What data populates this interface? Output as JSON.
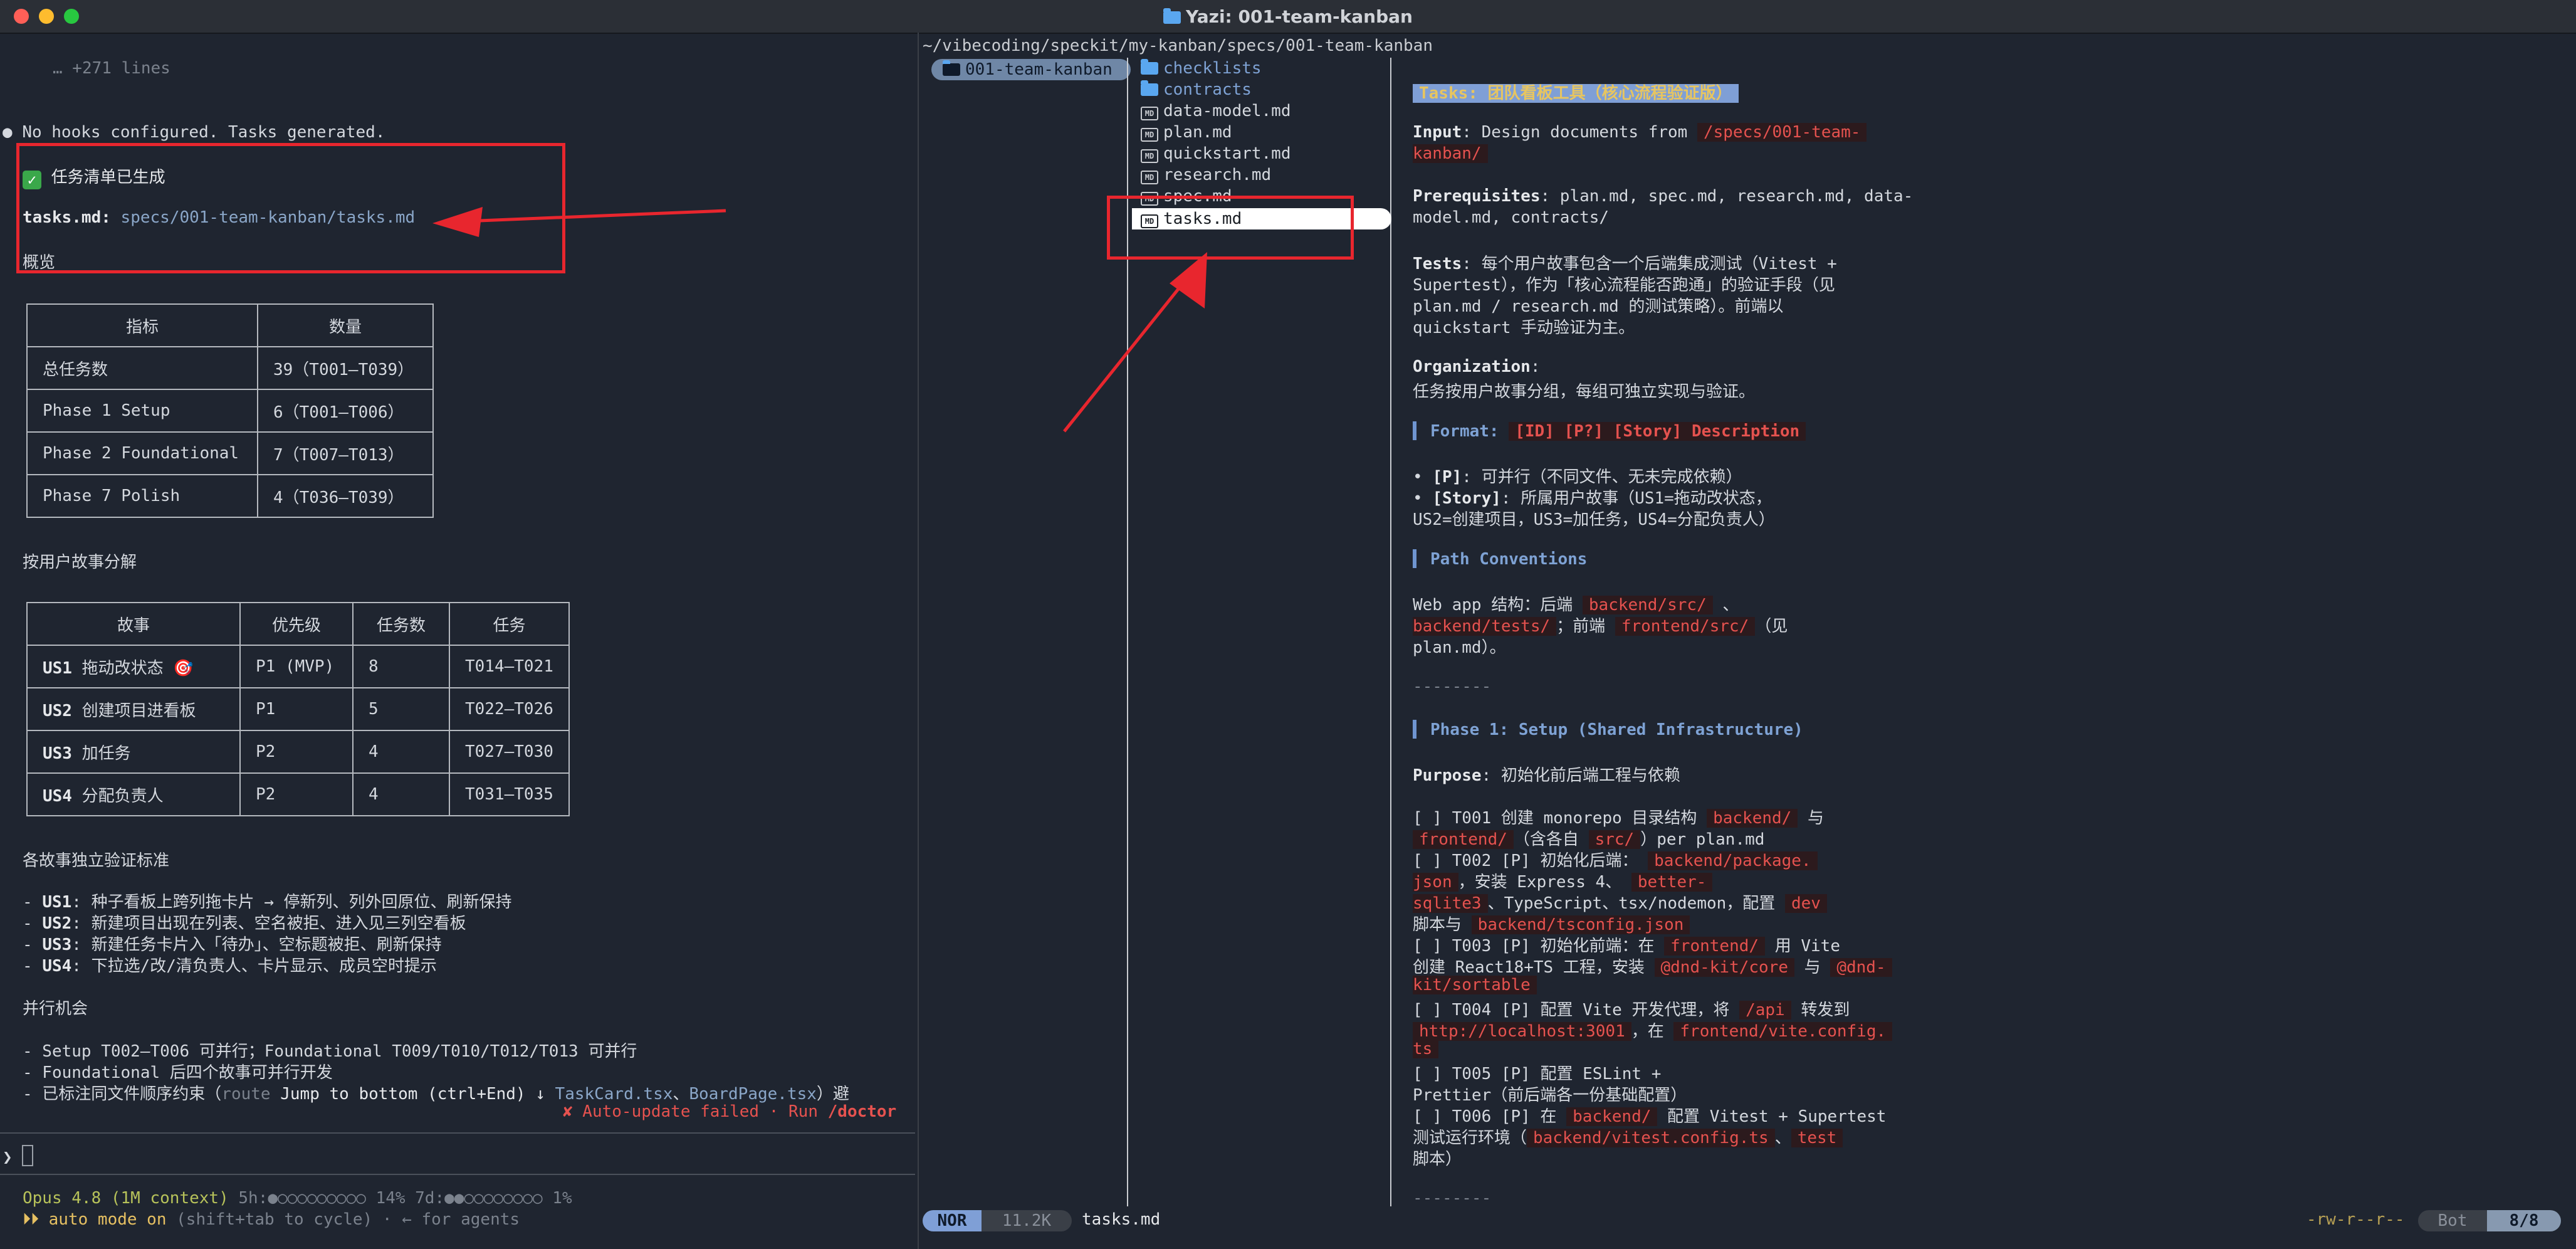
{
  "window": {
    "title": "Yazi: 001-team-kanban"
  },
  "left": {
    "collapsed": "… +271 lines",
    "hooks_msg": "No hooks configured. Tasks generated.",
    "done_title": "任务清单已生成",
    "tasks_label": "tasks.md:",
    "tasks_path": "specs/001-team-kanban/tasks.md",
    "overview": "概览",
    "table1": {
      "headers": [
        "指标",
        "数量"
      ],
      "rows": [
        [
          "总任务数",
          "39（T001–T039）"
        ],
        [
          "Phase 1 Setup",
          "6（T001–T006）"
        ],
        [
          "Phase 2 Foundational",
          "7（T007–T013）"
        ],
        [
          "Phase 7 Polish",
          "4（T036–T039）"
        ]
      ]
    },
    "by_story": "按用户故事分解",
    "table2": {
      "headers": [
        "故事",
        "优先级",
        "任务数",
        "任务"
      ],
      "rows": [
        {
          "id": "US1",
          "name": "拖动改状态 🎯",
          "prio": "P1 (MVP)",
          "count": "8",
          "tasks": "T014–T021"
        },
        {
          "id": "US2",
          "name": "创建项目进看板",
          "prio": "P1",
          "count": "5",
          "tasks": "T022–T026"
        },
        {
          "id": "US3",
          "name": "加任务",
          "prio": "P2",
          "count": "4",
          "tasks": "T027–T030"
        },
        {
          "id": "US4",
          "name": "分配负责人",
          "prio": "P2",
          "count": "4",
          "tasks": "T031–T035"
        }
      ]
    },
    "criteria_title": "各故事独立验证标准",
    "criteria": [
      {
        "k": "US1",
        "v": ": 种子看板上跨列拖卡片 → 停新列、列外回原位、刷新保持"
      },
      {
        "k": "US2",
        "v": ": 新建项目出现在列表、空名被拒、进入见三列空看板"
      },
      {
        "k": "US3",
        "v": ": 新建任务卡片入「待办」、空标题被拒、刷新保持"
      },
      {
        "k": "US4",
        "v": ": 下拉选/改/清负责人、卡片显示、成员空时提示"
      }
    ],
    "parallel_title": "并行机会",
    "parallel": [
      "- Setup T002–T006 可并行；Foundational T009/T010/T012/T013 可并行",
      "- Foundational 后四个故事可并行开发"
    ],
    "last_line_a": "- 已标注同文件顺序约束（",
    "last_line_route": "route",
    "last_line_jump": "Jump to bottom (ctrl+End) ↓",
    "last_line_b": "TaskCard.tsx",
    "last_line_c": "、",
    "last_line_d": "BoardPage.tsx",
    "last_line_e": "）避",
    "autoupdate": "✘ Auto-update failed · Run",
    "doctor": "/doctor",
    "prompt": "❯",
    "model": "Opus 4.8 (1M context)",
    "usage_5h": "5h:●○○○○○○○○○ 14%",
    "usage_7d": "7d:●●○○○○○○○○ 1%",
    "auto_mode": "⏵⏵ auto mode on",
    "auto_hint": "(shift+tab to cycle) · ← for agents"
  },
  "yazi": {
    "path": "~/vibecoding/speckit/my-kanban/specs/001-team-kanban",
    "parent_item": "001-team-kanban",
    "files": [
      {
        "name": "checklists",
        "type": "dir"
      },
      {
        "name": "contracts",
        "type": "dir"
      },
      {
        "name": "data-model.md",
        "type": "md"
      },
      {
        "name": "plan.md",
        "type": "md"
      },
      {
        "name": "quickstart.md",
        "type": "md"
      },
      {
        "name": "research.md",
        "type": "md"
      },
      {
        "name": "spec.md",
        "type": "md"
      },
      {
        "name": "tasks.md",
        "type": "md"
      }
    ],
    "md_icon": "MD",
    "preview": {
      "title": "Tasks: 团队看板工具（核心流程验证版）",
      "input_k": "Input",
      "input_v": ": Design documents from",
      "input_code1": "/specs/001-team-",
      "input_code2": "kanban/",
      "prereq_k": "Prerequisites",
      "prereq_v1": ": plan.md, spec.md, research.md, data-",
      "prereq_v2": "model.md, contracts/",
      "tests_k": "Tests",
      "tests_v1": ": 每个用户故事包含一个后端集成测试（Vitest +",
      "tests_v2": "Supertest），作为「核心流程能否跑通」的验证手段（见",
      "tests_v3": "plan.md / research.md 的测试策略）。前端以",
      "tests_v4": "quickstart 手动验证为主。",
      "org_k": "Organization",
      "org_v": "任务按用户故事分组，每组可独立实现与验证。",
      "format_h": "Format:",
      "format_code": "[ID] [P?] [Story] Description",
      "p_k": "[P]",
      "p_v": ": 可并行（不同文件、无未完成依赖）",
      "story_k": "[Story]",
      "story_v1": ": 所属用户故事（US1=拖动改状态，",
      "story_v2": "US2=创建项目，US3=加任务，US4=分配负责人）",
      "path_h": "Path Conventions",
      "web_a": "Web app 结构：后端",
      "web_c1": "backend/src/",
      "web_sep": "、",
      "web_c2": "backend/tests/",
      "web_b": "；前端",
      "web_c3": "frontend/src/",
      "web_d": "（见",
      "web_e": "plan.md）。",
      "sep": "--------",
      "phase1_h": "Phase 1: Setup (Shared Infrastructure)",
      "purpose_k": "Purpose",
      "purpose_v": ": 初始化前后端工程与依赖",
      "t001_a": "[ ] T001 创建 monorepo 目录结构",
      "t001_c1": "backend/",
      "t001_b": "与",
      "t001_c2": "frontend/",
      "t001_d": "（含各自",
      "t001_c3": "src/",
      "t001_e": "）per plan.md",
      "t002_a": "[ ] T002 [P] 初始化后端：",
      "t002_c1": "backend/package.",
      "t002_c1b": "json",
      "t002_b": "，安装 Express 4、",
      "t002_c2": "better-",
      "t002_c2b": "sqlite3",
      "t002_c": "、TypeScript、tsx/nodemon，配置",
      "t002_c3": "dev",
      "t002_d": "脚本与",
      "t002_c4": "backend/tsconfig.json",
      "t003_a": "[ ] T003 [P] 初始化前端：在",
      "t003_c1": "frontend/",
      "t003_b": "用 Vite",
      "t003_c": "创建 React18+TS 工程，安装",
      "t003_c2": "@dnd-kit/core",
      "t003_d": "与",
      "t003_c3": "@dnd-",
      "t003_c3b": "kit/sortable",
      "t004_a": "[ ] T004 [P] 配置 Vite 开发代理，将",
      "t004_c1": "/api",
      "t004_b": "转发到",
      "t004_c2": "http://localhost:3001",
      "t004_c": "，在",
      "t004_c3": "frontend/vite.config.",
      "t004_c3b": "ts",
      "t005_a": "[ ] T005 [P] 配置 ESLint +",
      "t005_b": "Prettier（前后端各一份基础配置）",
      "t006_a": "[ ] T006 [P] 在",
      "t006_c1": "backend/",
      "t006_b": "配置 Vitest + Supertest",
      "t006_c": "测试运行环境（",
      "t006_c2": "backend/vitest.config.ts",
      "t006_d": "、",
      "t006_c3": "test",
      "t006_e": "脚本）"
    },
    "status": {
      "mode": "NOR",
      "size": "11.2K",
      "file": "tasks.md",
      "perms": "-rw-r--r--",
      "pos": "Bot",
      "count": "8/8"
    }
  },
  "colors": {
    "annotation": "#e8262e",
    "selection": "#ffffff",
    "accent": "#7f9fd6"
  }
}
